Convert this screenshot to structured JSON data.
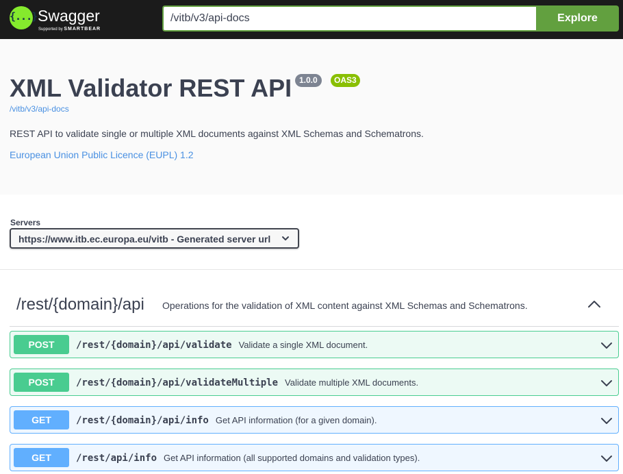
{
  "topbar": {
    "logo_text": "Swagger",
    "logo_glyph": "{...}",
    "logo_sub_prefix": "Supported by",
    "logo_sub_brand": "SMARTBEAR",
    "url_value": "/vitb/v3/api-docs",
    "explore_label": "Explore"
  },
  "info": {
    "title": "XML Validator REST API",
    "version": "1.0.0",
    "oas": "OAS3",
    "url": "/vitb/v3/api-docs",
    "description": "REST API to validate single or multiple XML documents against XML Schemas and Schematrons.",
    "license": "European Union Public Licence (EUPL) 1.2"
  },
  "servers": {
    "label": "Servers",
    "selected": "https://www.itb.ec.europa.eu/vitb - Generated server url"
  },
  "tag": {
    "name": "/rest/{domain}/api",
    "description": "Operations for the validation of XML content against XML Schemas and Schematrons."
  },
  "operations": [
    {
      "method": "POST",
      "path": "/rest/{domain}/api/validate",
      "summary": "Validate a single XML document."
    },
    {
      "method": "POST",
      "path": "/rest/{domain}/api/validateMultiple",
      "summary": "Validate multiple XML documents."
    },
    {
      "method": "GET",
      "path": "/rest/{domain}/api/info",
      "summary": "Get API information (for a given domain)."
    },
    {
      "method": "GET",
      "path": "/rest/api/info",
      "summary": "Get API information (all supported domains and validation types)."
    }
  ],
  "colors": {
    "topbar": "#1b1b1b",
    "accent": "#62a03f",
    "post": "#49cc90",
    "get": "#61affe",
    "link": "#4990e2"
  }
}
